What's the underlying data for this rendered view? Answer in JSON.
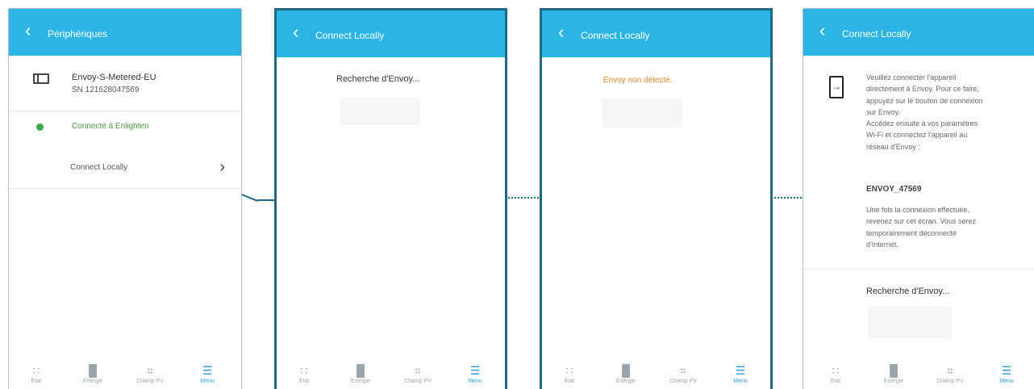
{
  "screen1": {
    "header_title": "Périphériques",
    "device_name": "Envoy-S-Metered-EU",
    "device_serial": "SN 121628047569",
    "status_text": "Connecté à Enlighten",
    "status_color": "#3aa84a",
    "connect_label": "Connect Locally"
  },
  "screen2": {
    "header_title": "Connect Locally",
    "searching_text": "Recherche d'Envoy..."
  },
  "screen3": {
    "header_title": "Connect Locally",
    "not_found_text": "Envoy non détecté.",
    "not_found_color": "#e08a2a"
  },
  "screen4": {
    "header_title": "Connect Locally",
    "instruction_lines": [
      "Veuillez connecter l'appareil",
      "directement à Envoy. Pour ce faire,",
      "appuyez sur le bouton de connexion",
      "sur Envoy.",
      "Accédez ensuite à vos paramètres",
      "Wi-Fi et connectez l'appareil au",
      "réseau d'Envoy :"
    ],
    "network_name": "ENVOY_47569",
    "after_lines": [
      "Une fois la connexion effectuée,",
      "revenez sur cet écran. Vous serez",
      "temporairement déconnecté",
      "d'Internet."
    ],
    "searching_text": "Recherche d'Envoy..."
  },
  "tabbar": {
    "tabs": [
      {
        "label": "Etat",
        "icon": "grid-icon"
      },
      {
        "label": "Energie",
        "icon": "bar-chart-icon"
      },
      {
        "label": "Champ PV",
        "icon": "solar-panel-icon"
      },
      {
        "label": "Menu",
        "icon": "menu-icon"
      }
    ],
    "active_tab": "Menu",
    "active_color": "#2a9bd4"
  },
  "colors": {
    "header_blue": "#2cb5e4",
    "annotation": "#1a6a88"
  }
}
